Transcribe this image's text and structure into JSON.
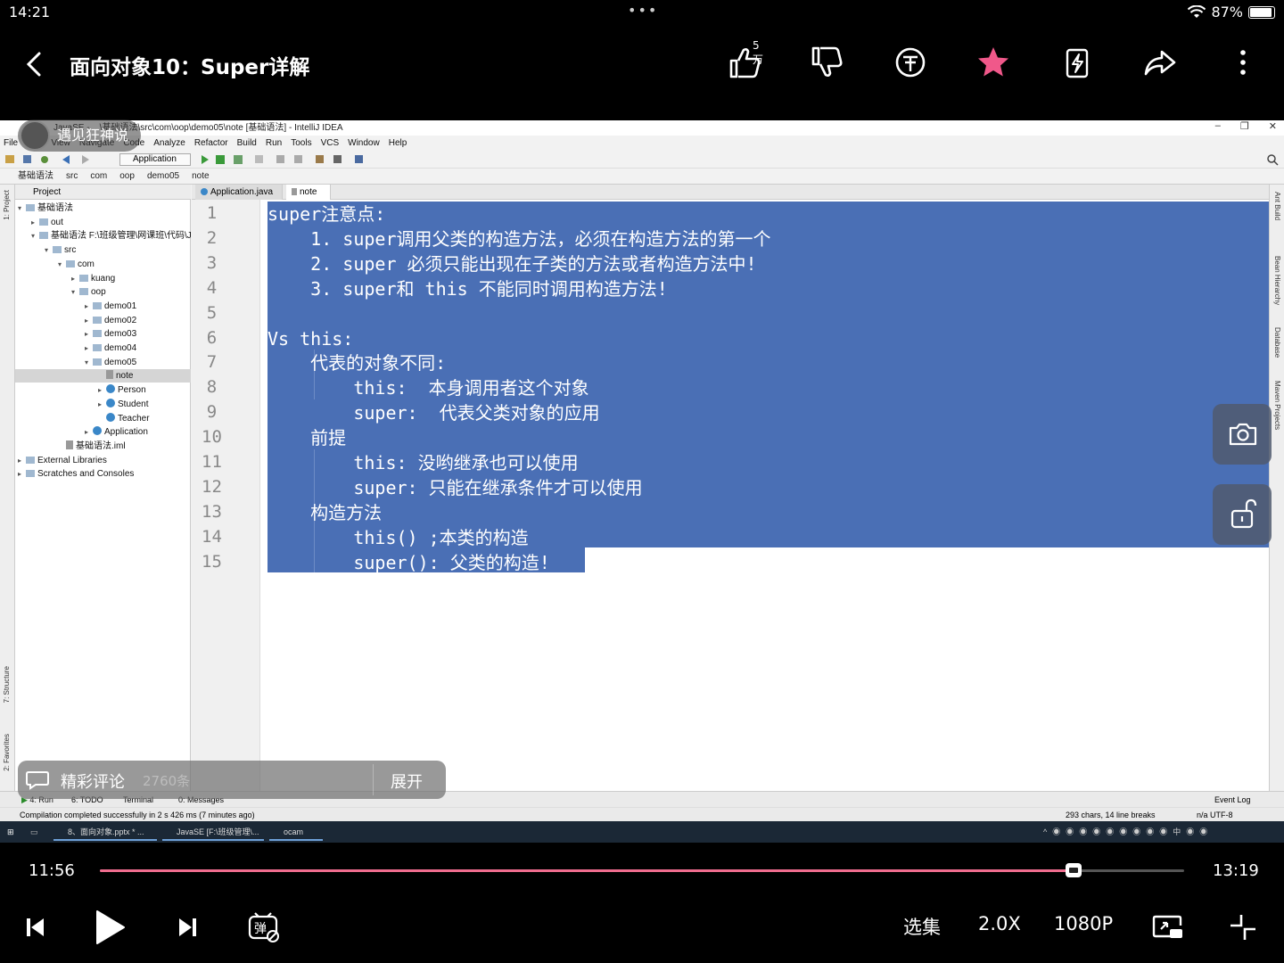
{
  "status_bar": {
    "time": "14:21",
    "dots": "•••",
    "battery": "87%",
    "battery_level": 0.87
  },
  "header": {
    "title": "面向对象10：Super详解",
    "like_count": "5万"
  },
  "ide": {
    "window_title": "JavaSE - ...\\基础语法\\src\\com\\oop\\demo05\\note [基础语法] - IntelliJ IDEA",
    "menu": [
      "File",
      "Edit",
      "View",
      "Navigate",
      "Code",
      "Analyze",
      "Refactor",
      "Build",
      "Run",
      "Tools",
      "VCS",
      "Window",
      "Help"
    ],
    "run_config": "Application",
    "breadcrumb": [
      "基础语法",
      "src",
      "com",
      "oop",
      "demo05",
      "note"
    ],
    "project_header": "Project",
    "tree": [
      {
        "label": "基础语法",
        "type": "folder",
        "depth": 0,
        "arrow": "▾"
      },
      {
        "label": "out",
        "type": "folder",
        "depth": 1,
        "arrow": "▸"
      },
      {
        "label": "基础语法  F:\\班级管理\\网课班\\代码\\Ja",
        "type": "folder",
        "depth": 1,
        "arrow": "▾"
      },
      {
        "label": "src",
        "type": "folder",
        "depth": 2,
        "arrow": "▾"
      },
      {
        "label": "com",
        "type": "folder",
        "depth": 3,
        "arrow": "▾"
      },
      {
        "label": "kuang",
        "type": "folder",
        "depth": 4,
        "arrow": "▸"
      },
      {
        "label": "oop",
        "type": "folder",
        "depth": 4,
        "arrow": "▾"
      },
      {
        "label": "demo01",
        "type": "folder",
        "depth": 5,
        "arrow": "▸"
      },
      {
        "label": "demo02",
        "type": "folder",
        "depth": 5,
        "arrow": "▸"
      },
      {
        "label": "demo03",
        "type": "folder",
        "depth": 5,
        "arrow": "▸"
      },
      {
        "label": "demo04",
        "type": "folder",
        "depth": 5,
        "arrow": "▸"
      },
      {
        "label": "demo05",
        "type": "folder",
        "depth": 5,
        "arrow": "▾"
      },
      {
        "label": "note",
        "type": "file",
        "depth": 6,
        "arrow": "",
        "selected": true
      },
      {
        "label": "Person",
        "type": "class",
        "depth": 6,
        "arrow": "▸"
      },
      {
        "label": "Student",
        "type": "class",
        "depth": 6,
        "arrow": "▸"
      },
      {
        "label": "Teacher",
        "type": "class",
        "depth": 6,
        "arrow": ""
      },
      {
        "label": "Application",
        "type": "class",
        "depth": 5,
        "arrow": "▸"
      },
      {
        "label": "基础语法.iml",
        "type": "file",
        "depth": 3,
        "arrow": ""
      },
      {
        "label": "External Libraries",
        "type": "folder",
        "depth": 0,
        "arrow": "▸"
      },
      {
        "label": "Scratches and Consoles",
        "type": "folder",
        "depth": 0,
        "arrow": "▸"
      }
    ],
    "tabs": [
      "Application.java",
      "note"
    ],
    "code_lines": [
      "super注意点:",
      "    1. super调用父类的构造方法，必须在构造方法的第一个",
      "    2. super 必须只能出现在子类的方法或者构造方法中!",
      "    3. super和 this 不能同时调用构造方法!",
      "",
      "Vs this:",
      "    代表的对象不同:",
      "        this:  本身调用者这个对象",
      "        super:  代表父类对象的应用",
      "    前提",
      "        this: 没哟继承也可以使用",
      "        super: 只能在继承条件才可以使用",
      "    构造方法",
      "        this() ;本类的构造",
      "        super(): 父类的构造!"
    ],
    "bottom_tools": [
      "4: Run",
      "6: TODO",
      "Terminal",
      "0: Messages",
      "Event Log"
    ],
    "status_message": "Compilation completed successfully in 2 s 426 ms (7 minutes ago)",
    "status_right": "293 chars, 14 line breaks",
    "status_encoding": "n/a  UTF-8",
    "left_strip": [
      "1: Project",
      "7: Structure",
      "2: Favorites"
    ],
    "right_strip": [
      "Ant Build",
      "Bean Hierarchy",
      "Database",
      "Maven Projects"
    ],
    "taskbar": [
      "8、面向对象.pptx * ...",
      "JavaSE [F:\\班级管理\\...",
      "ocam"
    ]
  },
  "overlays": {
    "watermark": "遇见狂神说",
    "comment_label": "精彩评论",
    "comment_count": "2760条",
    "expand_label": "展开"
  },
  "player": {
    "current_time": "11:56",
    "total_time": "13:19",
    "progress": 0.898,
    "episodes": "选集",
    "speed": "2.0X",
    "quality": "1080P"
  },
  "colors": {
    "accent": "#f06d8f",
    "selection": "#4a6fb5",
    "star": "#f0588a"
  }
}
